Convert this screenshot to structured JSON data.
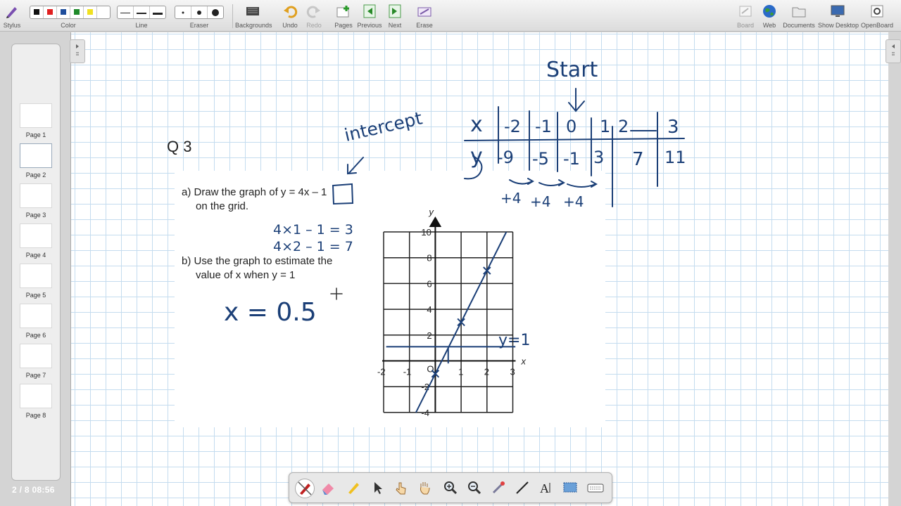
{
  "toolbar": {
    "stylus": "Stylus",
    "color": "Color",
    "line": "Line",
    "eraser": "Eraser",
    "backgrounds": "Backgrounds",
    "undo": "Undo",
    "redo": "Redo",
    "pages": "Pages",
    "previous": "Previous",
    "next": "Next",
    "erase": "Erase",
    "board": "Board",
    "web": "Web",
    "documents": "Documents",
    "show_desktop": "Show Desktop",
    "openboard": "OpenBoard",
    "colors": [
      "#111111",
      "#e02020",
      "#1f4e9c",
      "#1f8a2a",
      "#f0e020"
    ]
  },
  "thumbnails": [
    {
      "label": "Page 1"
    },
    {
      "label": "Page 2"
    },
    {
      "label": "Page 3"
    },
    {
      "label": "Page 4"
    },
    {
      "label": "Page 5"
    },
    {
      "label": "Page 6"
    },
    {
      "label": "Page 7"
    },
    {
      "label": "Page 8"
    }
  ],
  "status": {
    "page_counter": "2 / 8  08:56"
  },
  "question": {
    "number": "Q 3",
    "part_a_line1": "a) Draw the graph of y = 4x – 1",
    "part_a_line2": "on the grid.",
    "part_b_line1": "b) Use the graph to estimate the",
    "part_b_line2": "value of x when y = 1"
  },
  "annotations": {
    "start": "Start",
    "intercept": "intercept",
    "calc1": "4×1 – 1 = 3",
    "calc2": "4×2 – 1 = 7",
    "answer": "x = 0.5",
    "y_equals_1": "y=1",
    "differences": [
      "+4",
      "+4",
      "+4"
    ],
    "table_x_header": "x",
    "table_y_header": "y",
    "table_x": [
      "-2",
      "-1",
      "0",
      "1",
      "2",
      "3"
    ],
    "table_y": [
      "-9",
      "-5",
      "-1",
      "3",
      "7",
      "11"
    ]
  },
  "graph": {
    "x_axis_label": "x",
    "y_axis_label": "y",
    "origin_label": "O",
    "x_ticks": [
      "-2",
      "-1",
      "1",
      "2",
      "3"
    ],
    "y_ticks": [
      "10",
      "8",
      "6",
      "4",
      "2",
      "-2",
      "-4"
    ],
    "ink_color": "#1b3f77"
  }
}
